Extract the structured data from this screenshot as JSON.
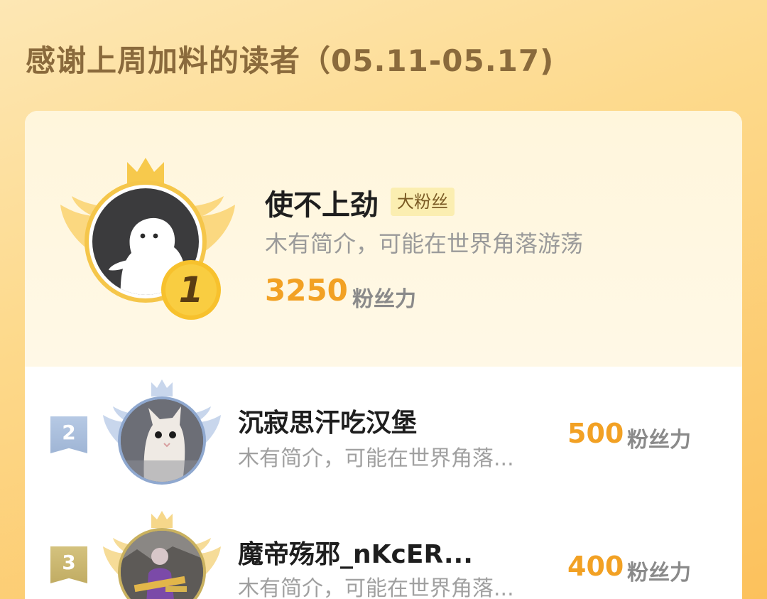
{
  "header": {
    "title": "感谢上周加料的读者（05.11-05.17)"
  },
  "top_reader": {
    "rank": "1",
    "name": "使不上劲",
    "badge": "大粉丝",
    "bio": "木有简介，可能在世界角落游荡",
    "score": "3250",
    "score_unit": "粉丝力",
    "avatar": "default-ghost-avatar"
  },
  "readers": [
    {
      "rank": "2",
      "name": "沉寂思汗吃汉堡",
      "bio": "木有简介，可能在世界角落...",
      "score": "500",
      "score_unit": "粉丝力",
      "avatar": "cat-photo-avatar"
    },
    {
      "rank": "3",
      "name": "魔帝殇邪_nKcER...",
      "bio": "木有简介，可能在世界角落...",
      "score": "400",
      "score_unit": "粉丝力",
      "avatar": "game-character-avatar"
    }
  ],
  "colors": {
    "accent_orange": "#f2a124",
    "gold_ring": "#f5c64a",
    "silver_ring": "#8fa8cf",
    "bronze_ring": "#c9b15f",
    "badge_bg": "#fbeeb1"
  }
}
